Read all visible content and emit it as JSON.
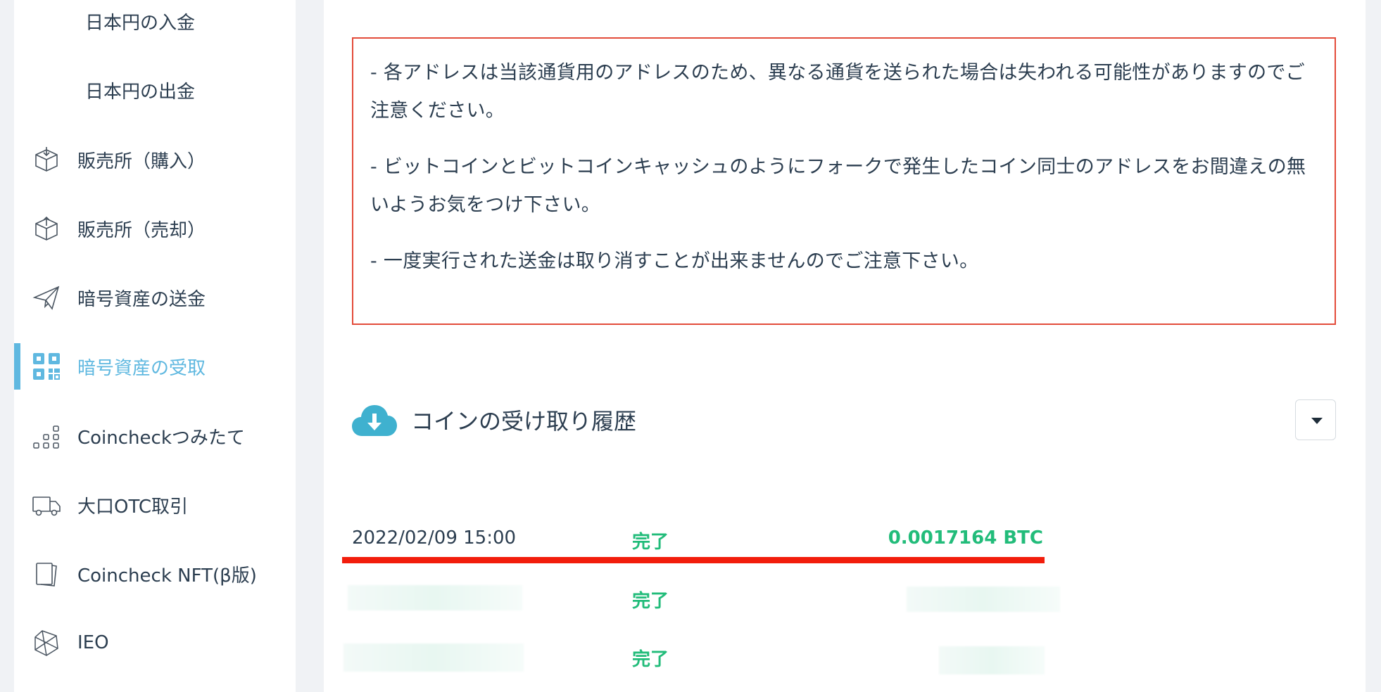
{
  "sidebar": {
    "items": [
      {
        "label": "日本円の入金",
        "icon": ""
      },
      {
        "label": "日本円の出金",
        "icon": ""
      },
      {
        "label": "販売所（購入）",
        "icon": "box-in-icon"
      },
      {
        "label": "販売所（売却）",
        "icon": "box-out-icon"
      },
      {
        "label": "暗号資産の送金",
        "icon": "paper-plane-icon"
      },
      {
        "label": "暗号資産の受取",
        "icon": "qr-code-icon",
        "active": true
      },
      {
        "label": "Coincheckつみたて",
        "icon": "dots-stairs-icon"
      },
      {
        "label": "大口OTC取引",
        "icon": "truck-icon"
      },
      {
        "label": "Coincheck NFT(β版)",
        "icon": "cards-icon"
      },
      {
        "label": "IEO",
        "icon": "gem-icon"
      }
    ]
  },
  "notice": {
    "lines": [
      "- 各アドレスは当該通貨用のアドレスのため、異なる通貨を送られた場合は失われる可能性がありますのでご注意ください。",
      "- ビットコインとビットコインキャッシュのようにフォークで発生したコイン同士のアドレスをお間違えの無いようお気をつけ下さい。",
      "- 一度実行された送金は取り消すことが出来ませんのでご注意下さい。"
    ]
  },
  "history": {
    "title": "コインの受け取り履歴",
    "rows": [
      {
        "date": "2022/02/09 15:00",
        "status": "完了",
        "amount": "0.0017164 BTC"
      },
      {
        "date": "",
        "status": "完了",
        "amount": ""
      },
      {
        "date": "",
        "status": "完了",
        "amount": ""
      }
    ]
  },
  "colors": {
    "accent": "#5fb8e0",
    "success": "#22bc7a",
    "notice_border": "#e34b3a",
    "highlight_underline": "#f21d0c"
  }
}
